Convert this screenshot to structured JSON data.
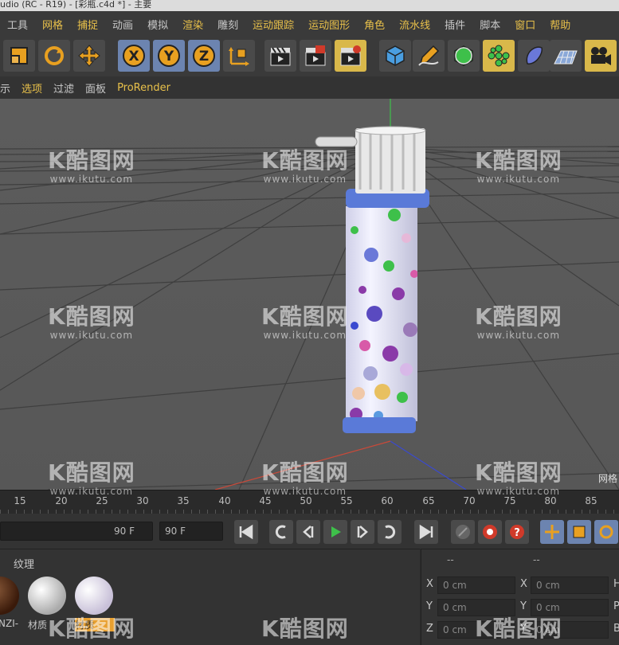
{
  "window_title": "udio (RC - R19) - [彩瓶.c4d *] - 主要",
  "menu": {
    "items": [
      "工具",
      "网格",
      "捕捉",
      "动画",
      "模拟",
      "渲染",
      "雕刻",
      "运动跟踪",
      "运动图形",
      "角色",
      "流水线",
      "插件",
      "脚本",
      "窗口",
      "帮助"
    ]
  },
  "toolbar": {
    "icons": [
      "scale-tool",
      "rotate-tool",
      "move-tool",
      "x-axis",
      "y-axis",
      "z-axis",
      "world-coord",
      "render-view",
      "render-picture-viewer",
      "render-settings",
      "cube",
      "pen",
      "subdivision",
      "cloner",
      "deformer",
      "floor",
      "camera"
    ],
    "axis_x": "X",
    "axis_y": "Y",
    "axis_z": "Z"
  },
  "viewport_menu": {
    "items": [
      "示",
      "选项",
      "过滤",
      "面板",
      "ProRender"
    ],
    "highlighted": "选项"
  },
  "viewport": {
    "corner_label": "网格"
  },
  "timeline": {
    "ticks": [
      "15",
      "20",
      "25",
      "30",
      "35",
      "40",
      "45",
      "50",
      "55",
      "60",
      "65",
      "70",
      "75",
      "80",
      "85"
    ]
  },
  "transport": {
    "end_frame": "90 F",
    "preview_end": "90 F"
  },
  "materials": {
    "tab_label": "纹理",
    "items": [
      {
        "label": "NZI-"
      },
      {
        "label": "材质"
      },
      {
        "label": "材质",
        "selected": true
      }
    ]
  },
  "coordinates": {
    "header_left": "--",
    "header_right": "--",
    "rows": [
      {
        "axis": "X",
        "value1": "0 cm",
        "axis2": "X",
        "value2": "0 cm",
        "axis3": "H"
      },
      {
        "axis": "Y",
        "value1": "0 cm",
        "axis2": "Y",
        "value2": "0 cm",
        "axis3": "P"
      },
      {
        "axis": "Z",
        "value1": "0 cm",
        "axis2": "Y",
        "value2": "0 cm",
        "axis3": "B"
      }
    ]
  },
  "watermark": {
    "logo": "K酷图网",
    "url": "www.ikutu.com"
  }
}
